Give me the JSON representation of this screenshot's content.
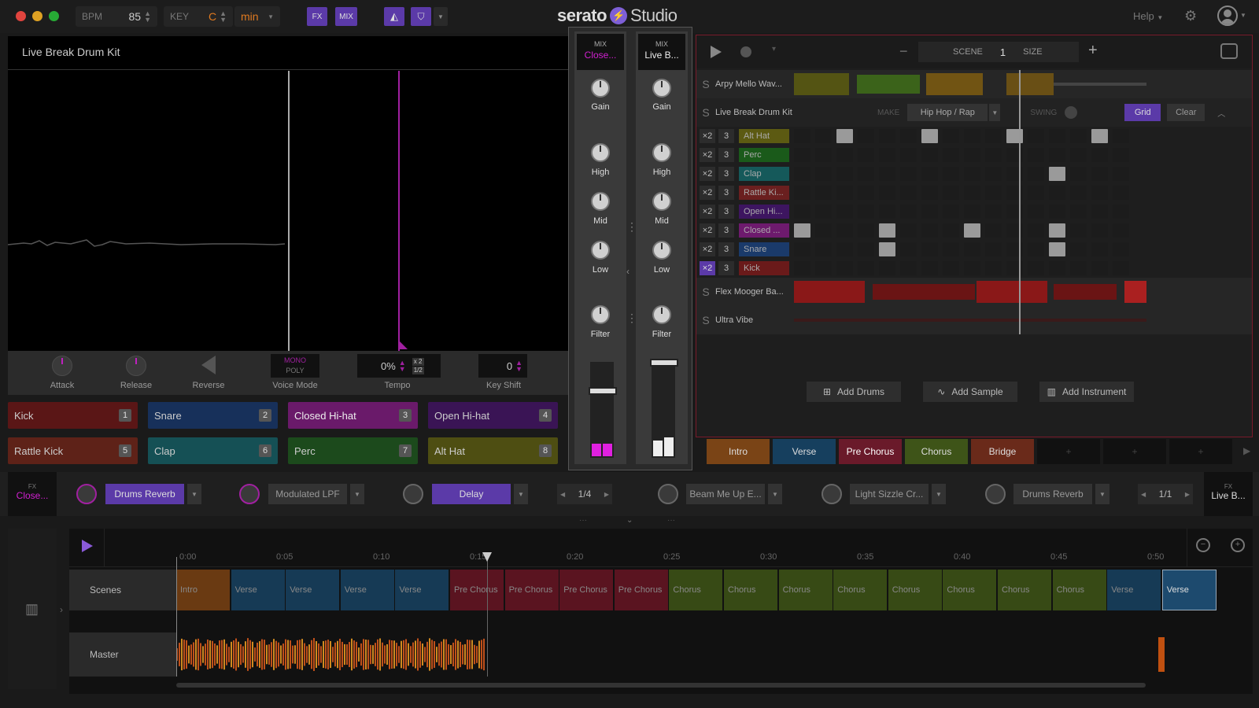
{
  "topbar": {
    "bpm_label": "BPM",
    "bpm_value": "85",
    "key_label": "KEY",
    "key_value": "C",
    "scale_value": "min",
    "fx_label": "FX",
    "mix_label": "MIX",
    "logo_main": "serato",
    "logo_studio": "Studio",
    "help_label": "Help"
  },
  "left_panel": {
    "title": "Live Break Drum Kit",
    "controls": {
      "attack": "Attack",
      "release": "Release",
      "reverse": "Reverse",
      "voice_mode": "Voice Mode",
      "mono": "MONO",
      "poly": "POLY",
      "tempo": "Tempo",
      "tempo_value": "0%",
      "x2": "x 2",
      "half": "1/2",
      "key_shift": "Key Shift",
      "key_shift_value": "0"
    },
    "pads": [
      {
        "label": "Kick",
        "num": "1"
      },
      {
        "label": "Snare",
        "num": "2"
      },
      {
        "label": "Closed Hi-hat",
        "num": "3"
      },
      {
        "label": "Open Hi-hat",
        "num": "4"
      },
      {
        "label": "Rattle Kick",
        "num": "5"
      },
      {
        "label": "Clap",
        "num": "6"
      },
      {
        "label": "Perc",
        "num": "7"
      },
      {
        "label": "Alt Hat",
        "num": "8"
      }
    ]
  },
  "mixer": {
    "left": {
      "head": "MIX",
      "name": "Close...",
      "gain": "Gain",
      "high": "High",
      "mid": "Mid",
      "low": "Low",
      "filter": "Filter"
    },
    "right": {
      "head": "MIX",
      "name": "Live B...",
      "gain": "Gain",
      "high": "High",
      "mid": "Mid",
      "low": "Low",
      "filter": "Filter"
    }
  },
  "right_panel": {
    "scene_label": "SCENE",
    "scene_value": "1",
    "size_label": "SIZE",
    "tracks": {
      "t1": "Arpy Mello Wav...",
      "t2": "Live Break Drum Kit",
      "t3": "Flex Mooger Ba...",
      "t4": "Ultra Vibe"
    },
    "make_label": "MAKE",
    "make_value": "Hip Hop / Rap",
    "swing_label": "SWING",
    "grid_label": "Grid",
    "clear_label": "Clear",
    "drum_rows": [
      {
        "x2": "×2",
        "n": "3",
        "name": "Alt Hat",
        "color": "#5c5a12"
      },
      {
        "x2": "×2",
        "n": "3",
        "name": "Perc",
        "color": "#1a5a1a"
      },
      {
        "x2": "×2",
        "n": "3",
        "name": "Clap",
        "color": "#15595a"
      },
      {
        "x2": "×2",
        "n": "3",
        "name": "Rattle Ki...",
        "color": "#6a1f1f"
      },
      {
        "x2": "×2",
        "n": "3",
        "name": "Open Hi...",
        "color": "#3d1560"
      },
      {
        "x2": "×2",
        "n": "3",
        "name": "Closed ...",
        "color": "#6d1a6d"
      },
      {
        "x2": "×2",
        "n": "3",
        "name": "Snare",
        "color": "#1a3a6a"
      },
      {
        "x2": "×2",
        "n": "3",
        "name": "Kick",
        "color": "#6a1a1a"
      }
    ],
    "add_drums": "Add Drums",
    "add_sample": "Add Sample",
    "add_instrument": "Add Instrument",
    "scenes": [
      {
        "label": "Intro",
        "color": "#7a4416"
      },
      {
        "label": "Verse",
        "color": "#163f5e"
      },
      {
        "label": "Pre Chorus",
        "color": "#6a1a2a"
      },
      {
        "label": "Chorus",
        "color": "#3e5418"
      },
      {
        "label": "Bridge",
        "color": "#6a2a1a"
      }
    ],
    "plus": "+"
  },
  "fx_row": {
    "left_fx_head": "FX",
    "left_fx_name": "Close...",
    "fx1": "Drums Reverb",
    "fx2": "Modulated LPF",
    "fx3": "Delay",
    "rate_left": "1/4",
    "fx4": "Beam Me Up E...",
    "fx5": "Light Sizzle Cr...",
    "fx6": "Drums Reverb",
    "rate_right": "1/1",
    "right_fx_head": "FX",
    "right_fx_name": "Live B..."
  },
  "timeline": {
    "scenes_label": "Scenes",
    "master_label": "Master",
    "ticks": [
      "0:00",
      "0:05",
      "0:10",
      "0:15",
      "0:20",
      "0:25",
      "0:30",
      "0:35",
      "0:40",
      "0:45",
      "0:50"
    ],
    "blocks": [
      {
        "label": "Intro",
        "color": "#6a3a12"
      },
      {
        "label": "Verse",
        "color": "#163a55"
      },
      {
        "label": "Verse",
        "color": "#163a55"
      },
      {
        "label": "Verse",
        "color": "#163a55"
      },
      {
        "label": "Verse",
        "color": "#163a55"
      },
      {
        "label": "Pre Chorus",
        "color": "#5a1420"
      },
      {
        "label": "Pre Chorus",
        "color": "#5a1420"
      },
      {
        "label": "Pre Chorus",
        "color": "#5a1420"
      },
      {
        "label": "Pre Chorus",
        "color": "#5a1420"
      },
      {
        "label": "Chorus",
        "color": "#374a15"
      },
      {
        "label": "Chorus",
        "color": "#374a15"
      },
      {
        "label": "Chorus",
        "color": "#374a15"
      },
      {
        "label": "Chorus",
        "color": "#374a15"
      },
      {
        "label": "Chorus",
        "color": "#374a15"
      },
      {
        "label": "Chorus",
        "color": "#374a15"
      },
      {
        "label": "Chorus",
        "color": "#374a15"
      },
      {
        "label": "Chorus",
        "color": "#374a15"
      },
      {
        "label": "Verse",
        "color": "#163a55"
      },
      {
        "label": "Verse",
        "color": "#1d4a6e"
      }
    ]
  }
}
